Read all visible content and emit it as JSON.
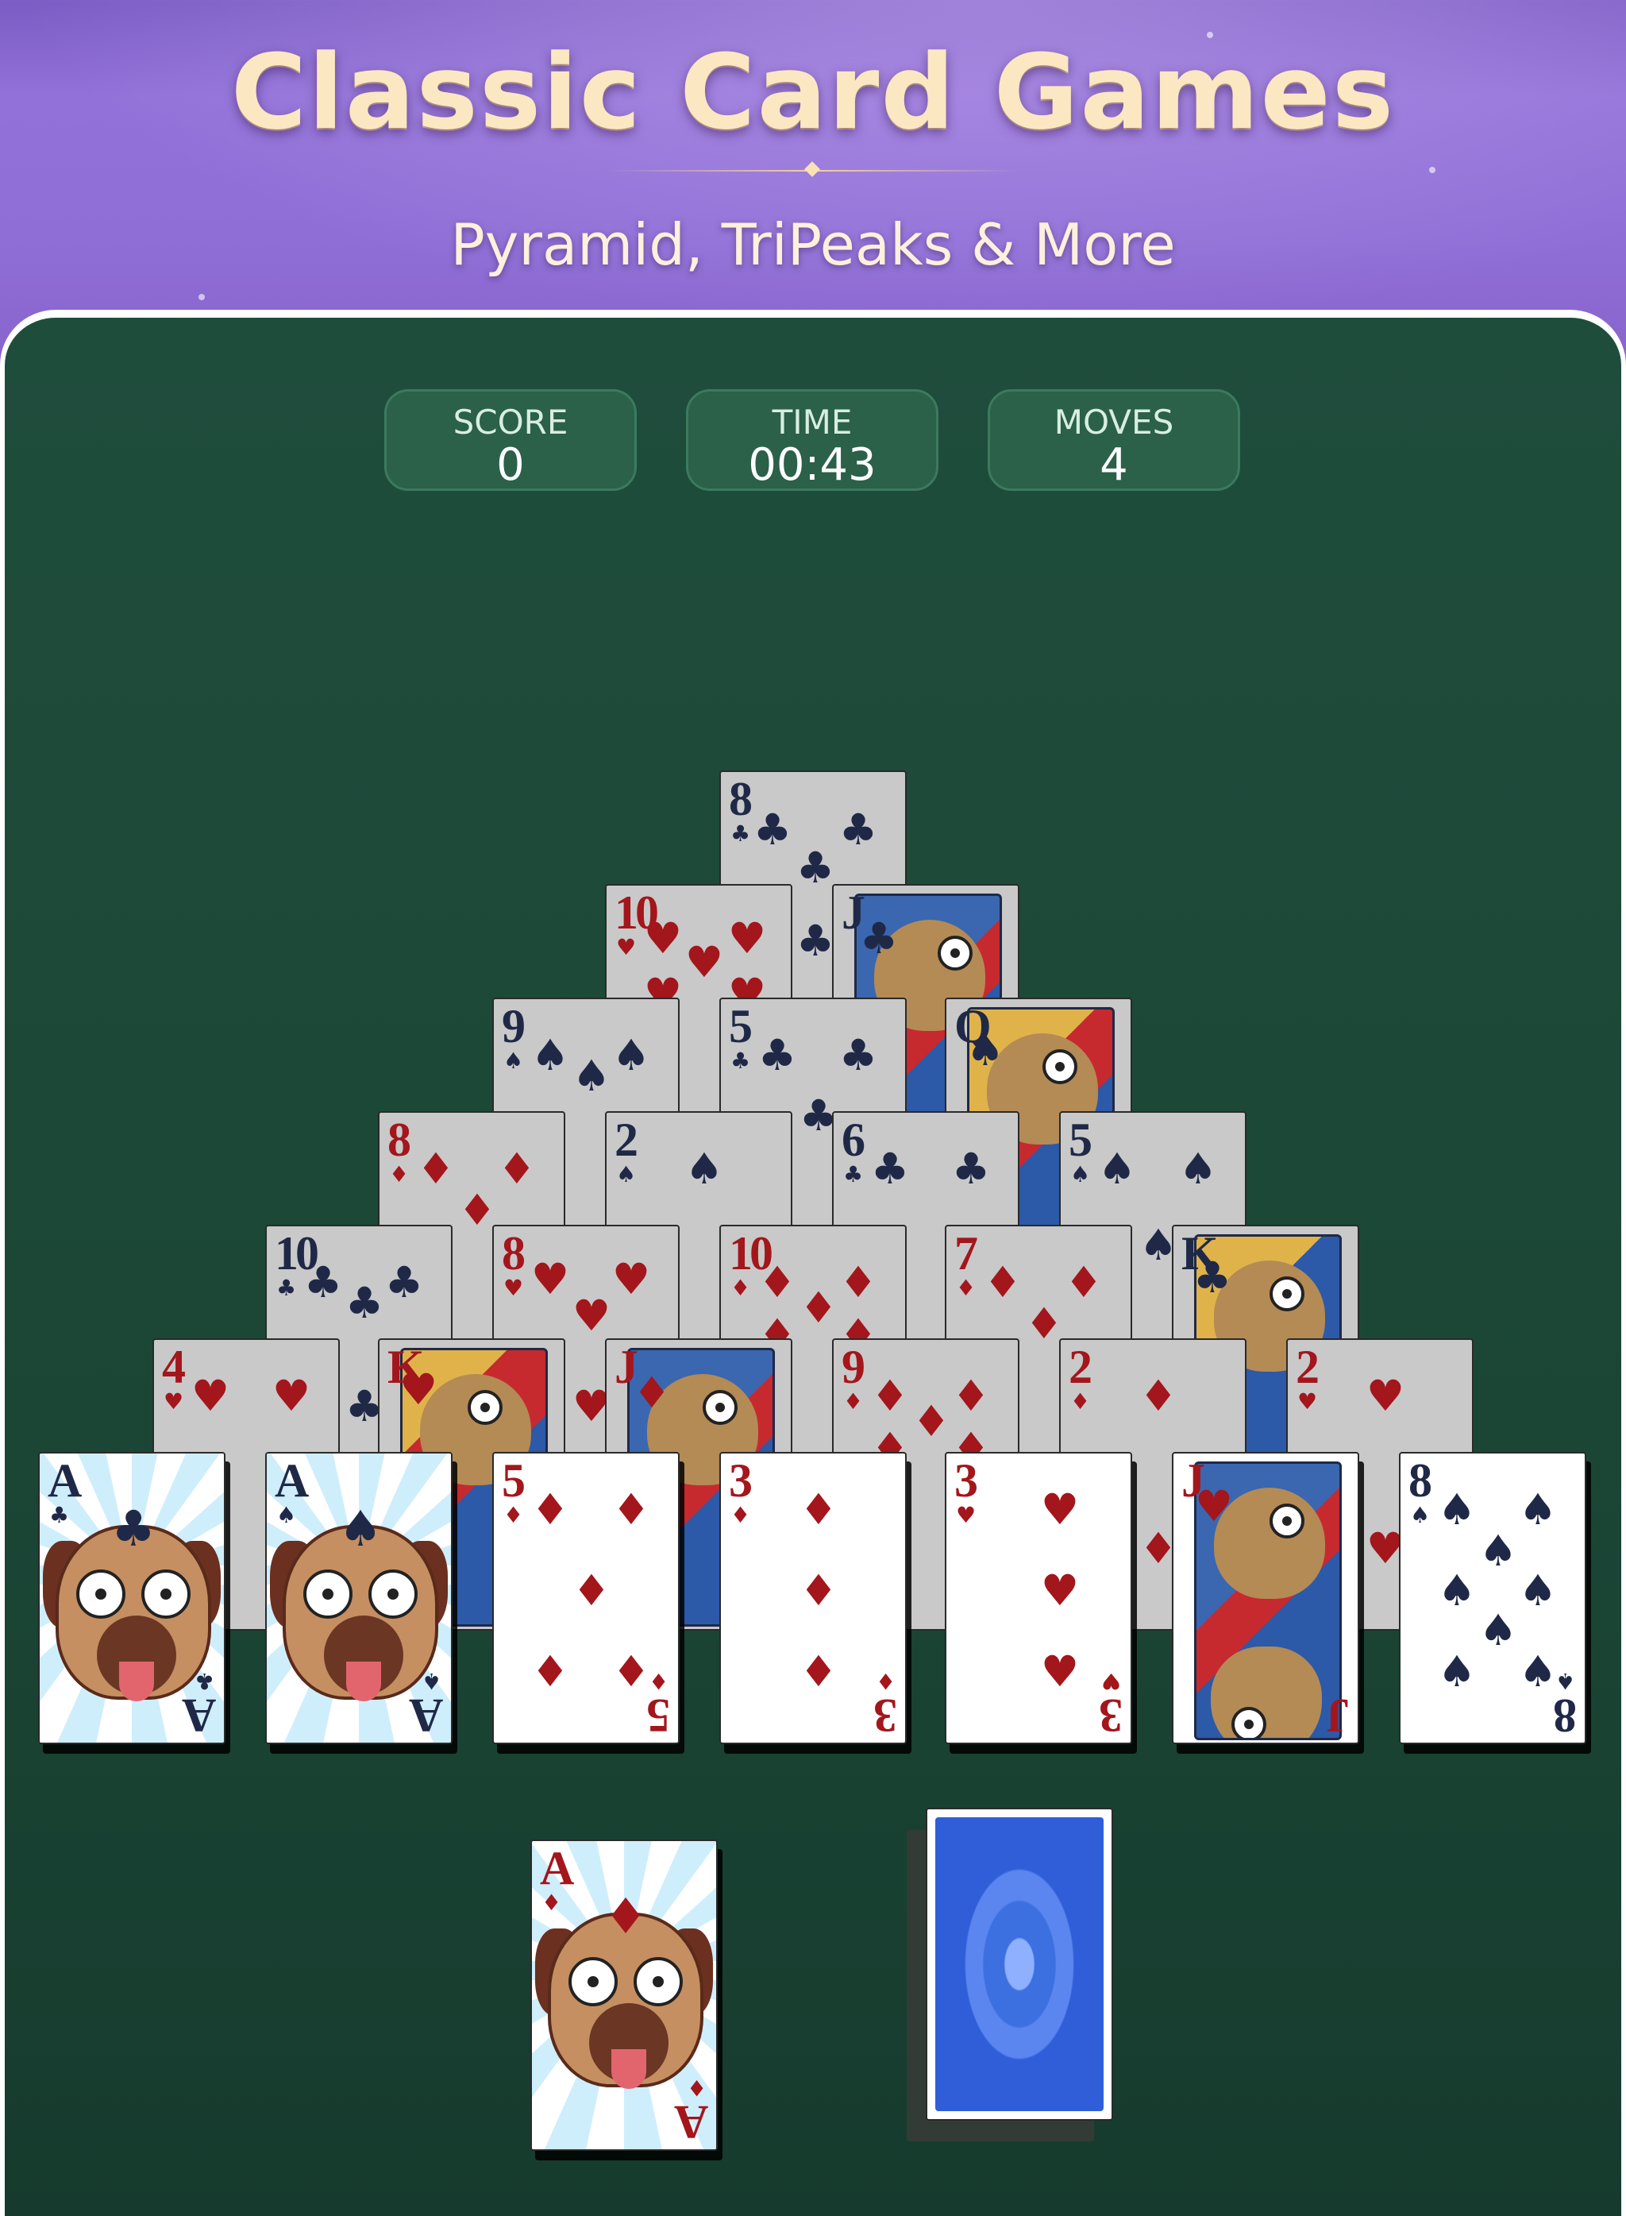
{
  "header": {
    "title": "Classic Card Games",
    "subtitle": "Pyramid, TriPeaks & More"
  },
  "stats": {
    "score_label": "SCORE",
    "score_value": "0",
    "time_label": "TIME",
    "time_value": "00:43",
    "moves_label": "MOVES",
    "moves_value": "4"
  },
  "colors": {
    "felt": "#1f4d3c",
    "banner": "#8f6fd6",
    "title": "#fbe7c2",
    "red_suit": "#a3161c",
    "black_suit": "#1f2947"
  },
  "pyramid": {
    "row1": [
      {
        "rank": "8",
        "suit": "♣"
      }
    ],
    "row2": [
      {
        "rank": "10",
        "suit": "♥"
      },
      {
        "rank": "J",
        "suit": "♣"
      }
    ],
    "row3": [
      {
        "rank": "9",
        "suit": "♠"
      },
      {
        "rank": "5",
        "suit": "♣"
      },
      {
        "rank": "Q",
        "suit": "♠"
      }
    ],
    "row4": [
      {
        "rank": "8",
        "suit": "♦"
      },
      {
        "rank": "2",
        "suit": "♠"
      },
      {
        "rank": "6",
        "suit": "♣"
      },
      {
        "rank": "5",
        "suit": "♠"
      }
    ],
    "row5": [
      {
        "rank": "10",
        "suit": "♣"
      },
      {
        "rank": "8",
        "suit": "♥"
      },
      {
        "rank": "10",
        "suit": "♦"
      },
      {
        "rank": "7",
        "suit": "♦"
      },
      {
        "rank": "K",
        "suit": "♣"
      }
    ],
    "row6": [
      {
        "rank": "4",
        "suit": "♥"
      },
      {
        "rank": "K",
        "suit": "♥"
      },
      {
        "rank": "J",
        "suit": "♦"
      },
      {
        "rank": "9",
        "suit": "♦"
      },
      {
        "rank": "2",
        "suit": "♦"
      },
      {
        "rank": "2",
        "suit": "♥"
      }
    ],
    "row7": [
      {
        "rank": "A",
        "suit": "♣"
      },
      {
        "rank": "A",
        "suit": "♠"
      },
      {
        "rank": "5",
        "suit": "♦"
      },
      {
        "rank": "3",
        "suit": "♦"
      },
      {
        "rank": "3",
        "suit": "♥"
      },
      {
        "rank": "J",
        "suit": "♥"
      },
      {
        "rank": "8",
        "suit": "♠"
      }
    ]
  },
  "waste": {
    "rank": "A",
    "suit": "♦"
  },
  "stock": {
    "label": ""
  }
}
